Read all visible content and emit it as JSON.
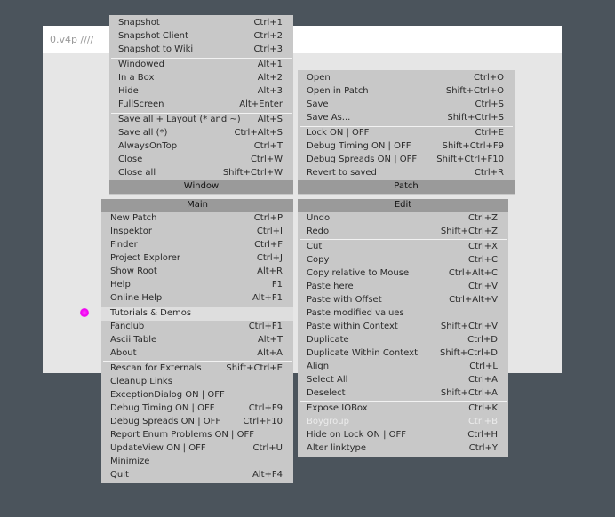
{
  "patch": {
    "title": "0.v4p ////"
  },
  "window_menu": {
    "title": "Window",
    "items": [
      {
        "label": "Snapshot",
        "key": "Ctrl+1"
      },
      {
        "label": "Snapshot Client",
        "key": "Ctrl+2"
      },
      {
        "label": "Snapshot to Wiki",
        "key": "Ctrl+3"
      },
      {
        "label": "Windowed",
        "key": "Alt+1"
      },
      {
        "label": "In a Box",
        "key": "Alt+2"
      },
      {
        "label": "Hide",
        "key": "Alt+3"
      },
      {
        "label": "FullScreen",
        "key": "Alt+Enter"
      },
      {
        "label": "Save all + Layout (* and ~)",
        "key": "Alt+S"
      },
      {
        "label": "Save all (*)",
        "key": "Ctrl+Alt+S"
      },
      {
        "label": "AlwaysOnTop",
        "key": "Ctrl+T"
      },
      {
        "label": "Close",
        "key": "Ctrl+W"
      },
      {
        "label": "Close all",
        "key": "Shift+Ctrl+W"
      }
    ]
  },
  "patch_menu": {
    "title": "Patch",
    "items": [
      {
        "label": "Open",
        "key": "Ctrl+O"
      },
      {
        "label": "Open in Patch",
        "key": "Shift+Ctrl+O"
      },
      {
        "label": "Save",
        "key": "Ctrl+S"
      },
      {
        "label": "Save As...",
        "key": "Shift+Ctrl+S"
      },
      {
        "label": "Lock ON | OFF",
        "key": "Ctrl+E"
      },
      {
        "label": "Debug Timing ON | OFF",
        "key": "Shift+Ctrl+F9"
      },
      {
        "label": "Debug Spreads ON | OFF",
        "key": "Shift+Ctrl+F10"
      },
      {
        "label": "Revert to saved",
        "key": "Ctrl+R"
      }
    ]
  },
  "main_menu": {
    "title": "Main",
    "items": [
      {
        "label": "New Patch",
        "key": "Ctrl+P"
      },
      {
        "label": "Inspektor",
        "key": "Ctrl+I"
      },
      {
        "label": "Finder",
        "key": "Ctrl+F"
      },
      {
        "label": "Project Explorer",
        "key": "Ctrl+J"
      },
      {
        "label": "Show Root",
        "key": "Alt+R"
      },
      {
        "label": "Help",
        "key": "F1"
      },
      {
        "label": "Online Help",
        "key": "Alt+F1"
      },
      {
        "label": "Tutorials & Demos",
        "key": ""
      },
      {
        "label": "Fanclub",
        "key": "Ctrl+F1"
      },
      {
        "label": "Ascii Table",
        "key": "Alt+T"
      },
      {
        "label": "About",
        "key": "Alt+A"
      },
      {
        "label": "Rescan for Externals",
        "key": "Shift+Ctrl+E"
      },
      {
        "label": "Cleanup Links",
        "key": ""
      },
      {
        "label": "ExceptionDialog ON | OFF",
        "key": ""
      },
      {
        "label": "Debug Timing ON | OFF",
        "key": "Ctrl+F9"
      },
      {
        "label": "Debug Spreads ON | OFF",
        "key": "Ctrl+F10"
      },
      {
        "label": "Report Enum Problems ON | OFF",
        "key": ""
      },
      {
        "label": "UpdateView ON | OFF",
        "key": "Ctrl+U"
      },
      {
        "label": "Minimize",
        "key": ""
      },
      {
        "label": "Quit",
        "key": "Alt+F4"
      }
    ]
  },
  "edit_menu": {
    "title": "Edit",
    "items": [
      {
        "label": "Undo",
        "key": "Ctrl+Z"
      },
      {
        "label": "Redo",
        "key": "Shift+Ctrl+Z"
      },
      {
        "label": "Cut",
        "key": "Ctrl+X"
      },
      {
        "label": "Copy",
        "key": "Ctrl+C"
      },
      {
        "label": "Copy relative to Mouse",
        "key": "Ctrl+Alt+C"
      },
      {
        "label": "Paste here",
        "key": "Ctrl+V"
      },
      {
        "label": "Paste with Offset",
        "key": "Ctrl+Alt+V"
      },
      {
        "label": "Paste modified values",
        "key": ""
      },
      {
        "label": "Paste within Context",
        "key": "Shift+Ctrl+V"
      },
      {
        "label": "Duplicate",
        "key": "Ctrl+D"
      },
      {
        "label": "Duplicate Within Context",
        "key": "Shift+Ctrl+D"
      },
      {
        "label": "Align",
        "key": "Ctrl+L"
      },
      {
        "label": "Select All",
        "key": "Ctrl+A"
      },
      {
        "label": "Deselect",
        "key": "Shift+Ctrl+A"
      },
      {
        "label": "Expose IOBox",
        "key": "Ctrl+K"
      },
      {
        "label": "Boygroup",
        "key": "Ctrl+B"
      },
      {
        "label": "Hide on Lock ON | OFF",
        "key": "Ctrl+H"
      },
      {
        "label": "Alter linktype",
        "key": "Ctrl+Y"
      }
    ]
  }
}
